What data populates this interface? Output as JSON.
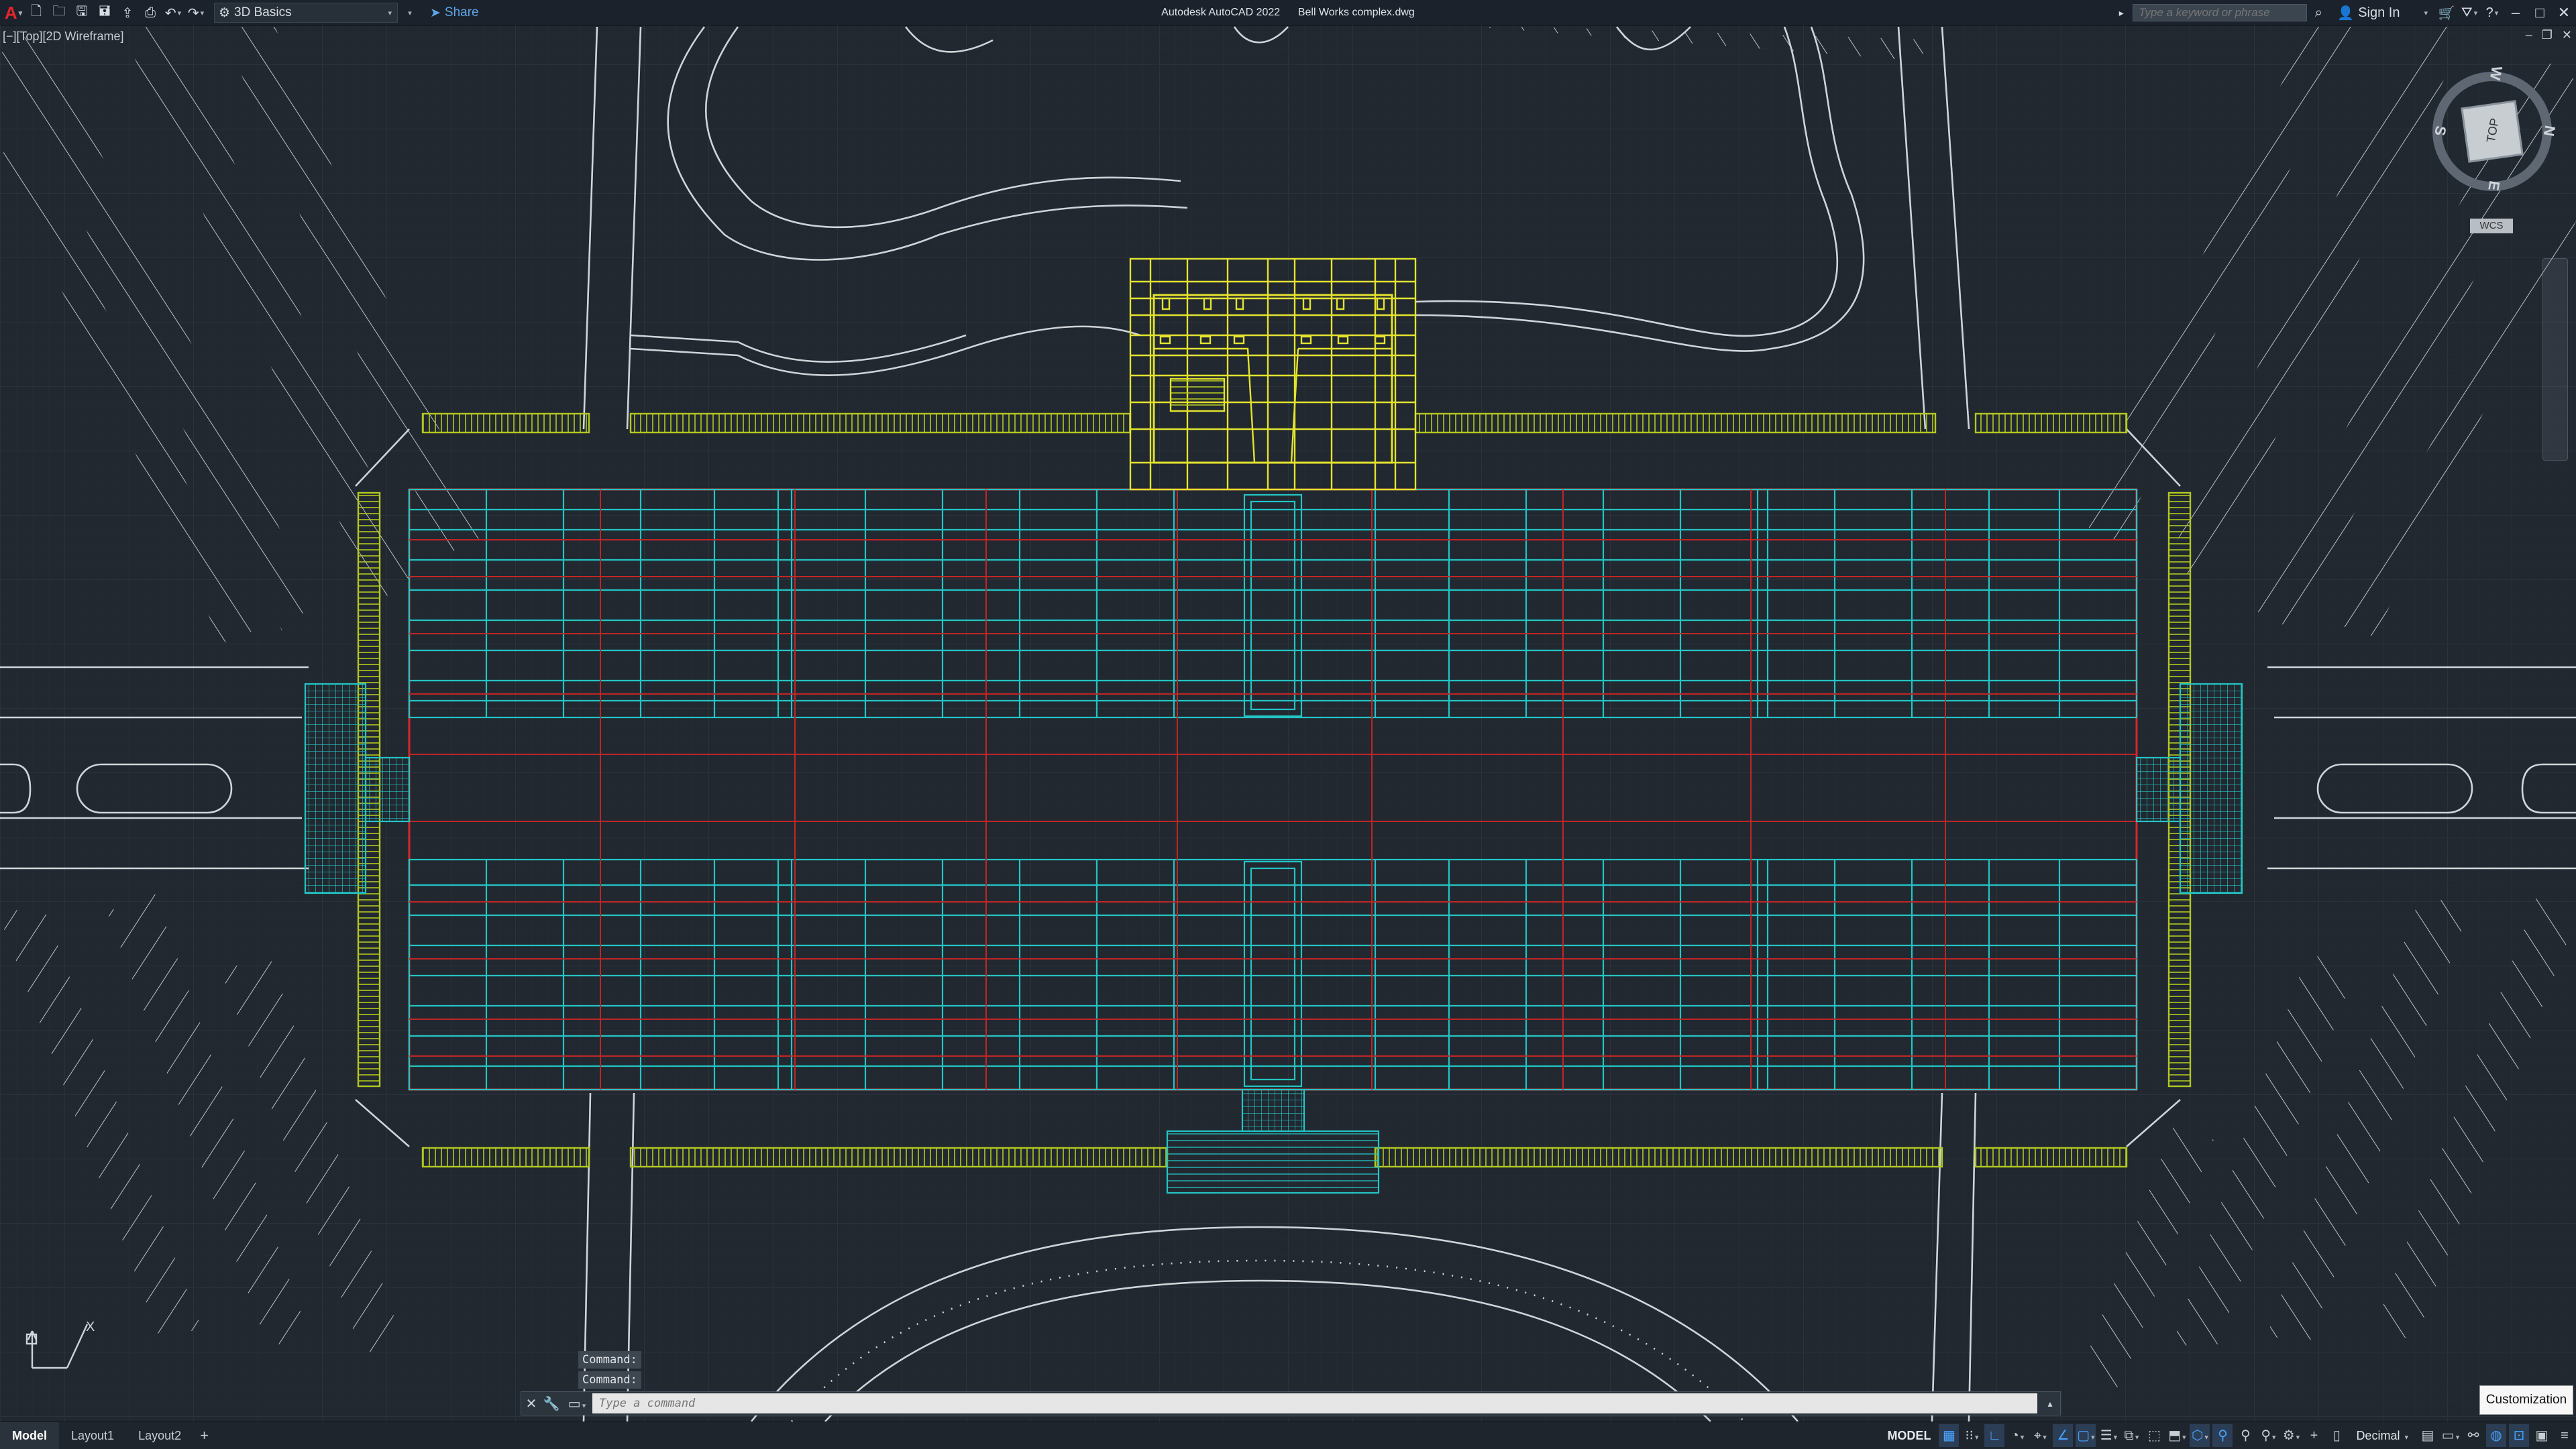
{
  "titlebar": {
    "app_name": "Autodesk AutoCAD 2022",
    "file_name": "Bell Works complex.dwg",
    "workspace": "3D Basics",
    "share_label": "Share",
    "search_placeholder": "Type a keyword or phrase",
    "signin_label": "Sign In"
  },
  "viewport": {
    "label": "[−][Top][2D Wireframe]"
  },
  "viewcube": {
    "face": "TOP",
    "north": "N",
    "south": "S",
    "east": "E",
    "west": "W",
    "ucs_label": "WCS"
  },
  "ucs_icon": {
    "x_label": "X",
    "y_label": "Y"
  },
  "command": {
    "history": [
      "Command:",
      "Command:"
    ],
    "placeholder": "Type a command"
  },
  "layout_tabs": [
    "Model",
    "Layout1",
    "Layout2"
  ],
  "status": {
    "space": "MODEL",
    "units": "Decimal"
  },
  "tooltip": "Customization",
  "colors": {
    "background": "#212830",
    "building_outline": "#d42a2a",
    "floor_grid": "#24c4c4",
    "annex": "#e3e32e",
    "walkway": "#b3c820",
    "roads": "#d0d4d8"
  }
}
